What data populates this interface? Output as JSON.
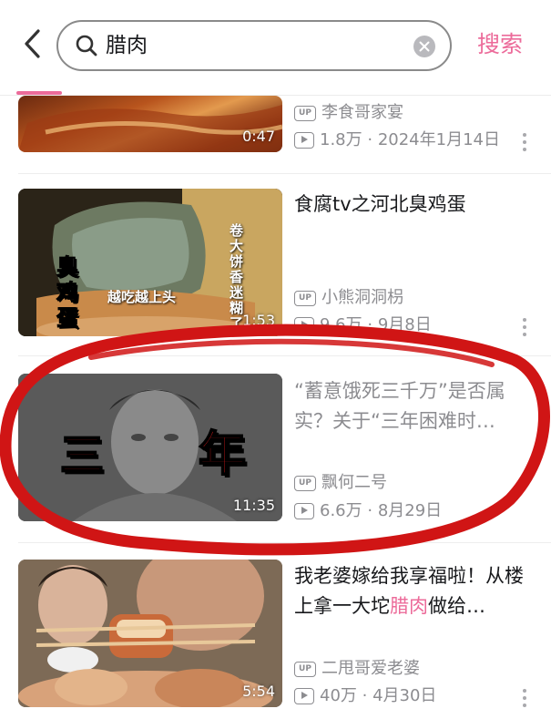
{
  "header": {
    "back_icon": "chevron-left-icon",
    "search_icon": "search-icon",
    "query": "腊肉",
    "clear_icon": "clear-icon",
    "search_label": "搜索",
    "accent": "#ec6b9a"
  },
  "results": [
    {
      "title": "",
      "uploader": "李食哥家宴",
      "views": "1.8万",
      "date": "2024年1月14日",
      "duration": "0:47"
    },
    {
      "title": "食腐tv之河北臭鸡蛋",
      "uploader": "小熊洞洞枴",
      "views": "9.6万",
      "date": "9月8日",
      "duration": "1:53",
      "thumb_text_left": "臭鸡蛋",
      "thumb_text_mid": "越吃越上头",
      "thumb_text_right": "卷大饼香迷糊了"
    },
    {
      "title": "“蓄意饿死三千万”是否属实？关于“三年困难时…",
      "uploader": "飘何二号",
      "views": "6.6万",
      "date": "8月29日",
      "duration": "11:35",
      "thumb_char_1": "三",
      "thumb_char_2": "年"
    },
    {
      "title_part1": "我老婆嫁给我享福啦！从楼上拿一大坨",
      "title_highlight": "腊肉",
      "title_part2": "做给…",
      "uploader": "二甩哥爱老婆",
      "views": "40万",
      "date": "4月30日",
      "duration": "5:54"
    }
  ],
  "separator": " · ",
  "up_badge": "UP",
  "annotation_color": "#d01515"
}
